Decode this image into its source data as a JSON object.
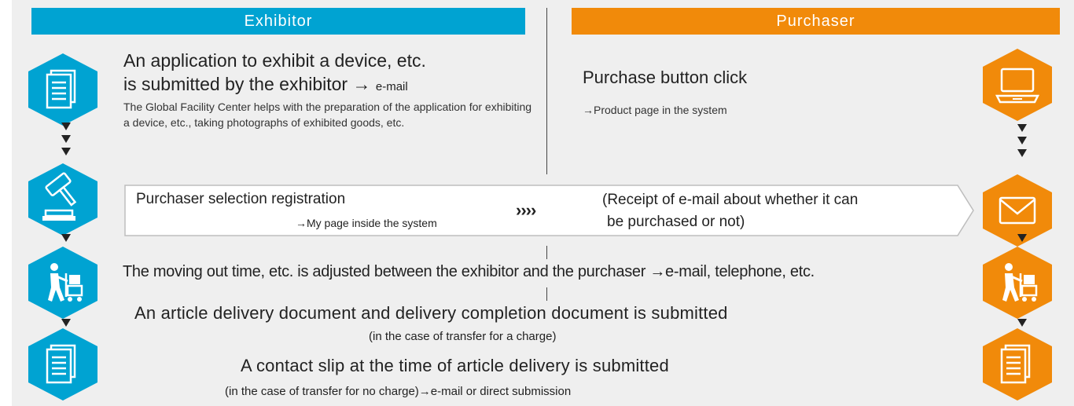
{
  "headers": {
    "exhibitor": "Exhibitor",
    "purchaser": "Purchaser"
  },
  "colors": {
    "exhibitor": "#00a3d2",
    "purchaser": "#f18a0a",
    "background": "#efefef"
  },
  "steps": {
    "application": {
      "line1": "An application to exhibit a device, etc.",
      "line2": "is submitted by the exhibitor",
      "arrow": "→",
      "channel": "e-mail",
      "detail": "The Global Facility Center helps with the preparation of the application for exhibiting a device, etc., taking photographs of exhibited goods, etc."
    },
    "purchase": {
      "title": "Purchase button click",
      "note": "→Product page in the system"
    },
    "selection": {
      "title": "Purchaser selection registration",
      "note": "→My page inside the system",
      "chevrons": "››››",
      "receipt_line1": "(Receipt of e-mail about whether it can",
      "receipt_line2": "be purchased or not)"
    },
    "moving": {
      "text": "The moving out time, etc. is adjusted between the exhibitor and the purchaser →e-mail, telephone, etc."
    },
    "delivery_document": {
      "title": "An article delivery document and delivery completion document is submitted",
      "note": "(in the case of transfer for a charge)"
    },
    "contact_slip": {
      "title": "A contact slip at the time of article delivery is submitted",
      "note": "(in the case of transfer for no charge)→e-mail or direct submission"
    }
  },
  "icons": {
    "exhibitor": [
      "document-icon",
      "gavel-icon",
      "mover-with-cart-icon",
      "document-icon"
    ],
    "purchaser": [
      "laptop-icon",
      "envelope-icon",
      "mover-with-cart-icon",
      "document-icon"
    ]
  }
}
